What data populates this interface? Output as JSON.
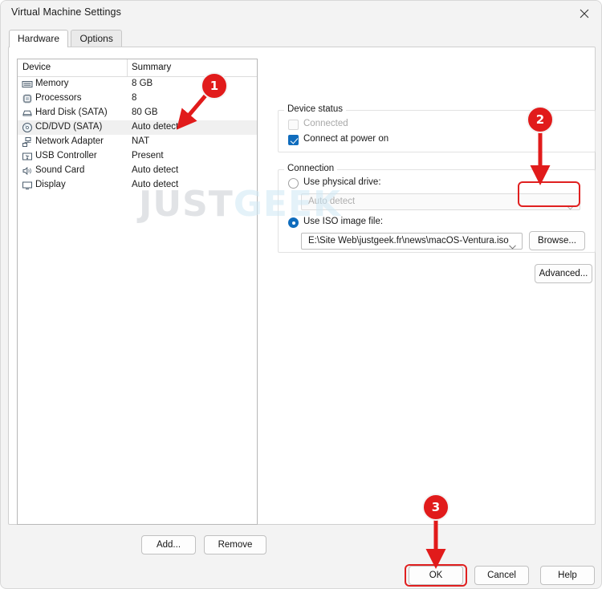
{
  "window": {
    "title": "Virtual Machine Settings",
    "close_icon": "close-icon"
  },
  "tabs": [
    {
      "label": "Hardware",
      "active": true
    },
    {
      "label": "Options",
      "active": false
    }
  ],
  "device_list": {
    "columns": {
      "device": "Device",
      "summary": "Summary"
    },
    "rows": [
      {
        "icon": "memory-icon",
        "name": "Memory",
        "summary": "8 GB",
        "selected": false
      },
      {
        "icon": "processor-icon",
        "name": "Processors",
        "summary": "8",
        "selected": false
      },
      {
        "icon": "hard-disk-icon",
        "name": "Hard Disk (SATA)",
        "summary": "80 GB",
        "selected": false
      },
      {
        "icon": "cd-dvd-icon",
        "name": "CD/DVD (SATA)",
        "summary": "Auto detect",
        "selected": true
      },
      {
        "icon": "network-adapter-icon",
        "name": "Network Adapter",
        "summary": "NAT",
        "selected": false
      },
      {
        "icon": "usb-controller-icon",
        "name": "USB Controller",
        "summary": "Present",
        "selected": false
      },
      {
        "icon": "sound-card-icon",
        "name": "Sound Card",
        "summary": "Auto detect",
        "selected": false
      },
      {
        "icon": "display-icon",
        "name": "Display",
        "summary": "Auto detect",
        "selected": false
      }
    ]
  },
  "list_buttons": {
    "add": "Add...",
    "remove": "Remove"
  },
  "device_status": {
    "group_title": "Device status",
    "connected": {
      "label": "Connected",
      "checked": false,
      "disabled": true
    },
    "connect_at_power_on": {
      "label": "Connect at power on",
      "checked": true,
      "disabled": false
    }
  },
  "connection": {
    "group_title": "Connection",
    "use_physical_drive": {
      "label": "Use physical drive:",
      "selected": false
    },
    "physical_drive_value": "Auto detect",
    "use_iso_image": {
      "label": "Use ISO image file:",
      "selected": true
    },
    "iso_path": "E:\\Site Web\\justgeek.fr\\news\\macOS-Ventura.iso",
    "browse": "Browse...",
    "advanced": "Advanced..."
  },
  "footer": {
    "ok": "OK",
    "cancel": "Cancel",
    "help": "Help"
  },
  "annotations": {
    "color": "#e11b1b",
    "markers": [
      {
        "number": "1",
        "target": "cd-dvd-row"
      },
      {
        "number": "2",
        "target": "browse-button"
      },
      {
        "number": "3",
        "target": "ok-button"
      }
    ]
  },
  "watermark": {
    "part1": "JUST",
    "part2": "GEEK",
    "color1": "#c9cdd2",
    "color2": "#cfe8f5"
  }
}
